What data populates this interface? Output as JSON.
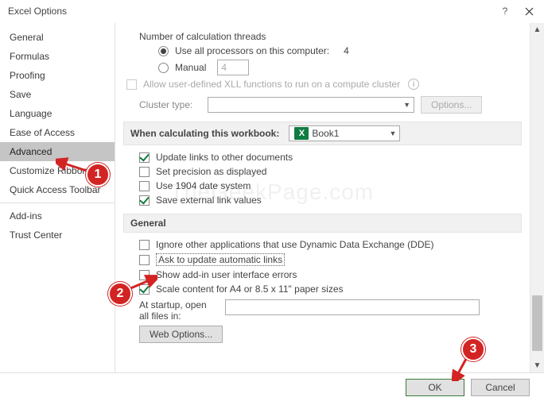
{
  "title": "Excel Options",
  "sidebar": {
    "items": [
      {
        "label": "General"
      },
      {
        "label": "Formulas"
      },
      {
        "label": "Proofing"
      },
      {
        "label": "Save"
      },
      {
        "label": "Language"
      },
      {
        "label": "Ease of Access"
      },
      {
        "label": "Advanced"
      },
      {
        "label": "Customize Ribbon"
      },
      {
        "label": "Quick Access Toolbar"
      },
      {
        "label": "Add-ins"
      },
      {
        "label": "Trust Center"
      }
    ],
    "selected": "Advanced"
  },
  "calc": {
    "threads_label": "Number of calculation threads",
    "use_all_label": "Use all processors on this computer:",
    "use_all_count": "4",
    "manual_label": "Manual",
    "manual_value": "4",
    "allow_udf_label": "Allow user-defined XLL functions to run on a compute cluster",
    "cluster_label": "Cluster type:",
    "options_btn": "Options..."
  },
  "workbook_section": {
    "header": "When calculating this workbook:",
    "book_name": "Book1",
    "update_links": "Update links to other documents",
    "set_precision": "Set precision as displayed",
    "use_1904": "Use 1904 date system",
    "save_external": "Save external link values"
  },
  "general_section": {
    "header": "General",
    "ignore_dde": "Ignore other applications that use Dynamic Data Exchange (DDE)",
    "ask_update": "Ask to update automatic links",
    "show_addin_errors": "Show add-in user interface errors",
    "scale_content": "Scale content for A4 or 8.5 x 11\" paper sizes",
    "startup_label": "At startup, open all files in:",
    "web_options_btn": "Web Options..."
  },
  "footer": {
    "ok": "OK",
    "cancel": "Cancel"
  },
  "annotations": {
    "b1": "1",
    "b2": "2",
    "b3": "3"
  },
  "watermark": "TheGeekPage.com"
}
